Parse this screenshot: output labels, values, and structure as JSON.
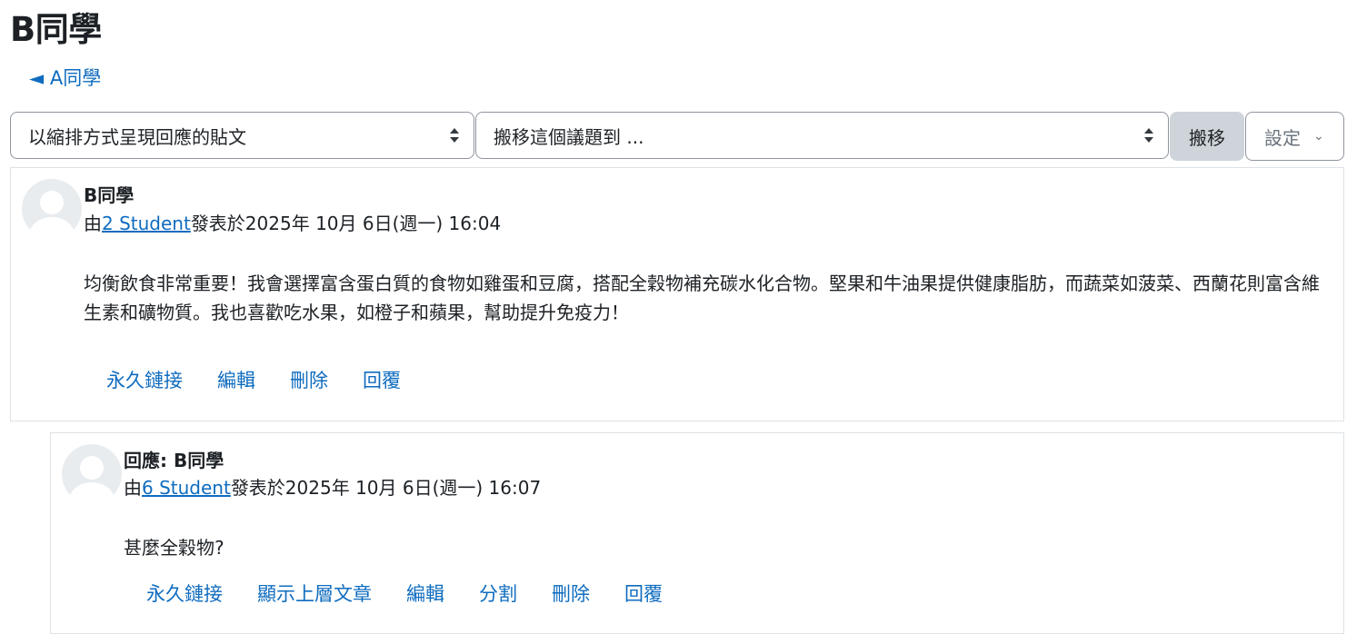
{
  "page_title": "B同學",
  "back_link": "◄ A同學",
  "toolbar": {
    "display_mode": "以縮排方式呈現回應的貼文",
    "move_select_placeholder": "搬移這個議題到 ...",
    "move_button": "搬移",
    "settings_button": "設定"
  },
  "posts": [
    {
      "subject": "B同學",
      "by_prefix": "由",
      "author": "2 Student",
      "posted_suffix": "發表於2025年 10月 6日(週一) 16:04",
      "content": "均衡飲食非常重要！我會選擇富含蛋白質的食物如雞蛋和豆腐，搭配全穀物補充碳水化合物。堅果和牛油果提供健康脂肪，而蔬菜如菠菜、西蘭花則富含維生素和礦物質。我也喜歡吃水果，如橙子和蘋果，幫助提升免疫力！",
      "actions": [
        "永久鏈接",
        "編輯",
        "刪除",
        "回覆"
      ]
    },
    {
      "subject": "回應: B同學",
      "by_prefix": "由",
      "author": "6 Student",
      "posted_suffix": "發表於2025年 10月 6日(週一) 16:07",
      "content": "甚麼全穀物?",
      "actions": [
        "永久鏈接",
        "顯示上層文章",
        "編輯",
        "分割",
        "刪除",
        "回覆"
      ]
    }
  ],
  "colors": {
    "link": "#0f6cbf",
    "text": "#1d2125",
    "border": "#dee2e6",
    "button_bg": "#ced4da"
  }
}
